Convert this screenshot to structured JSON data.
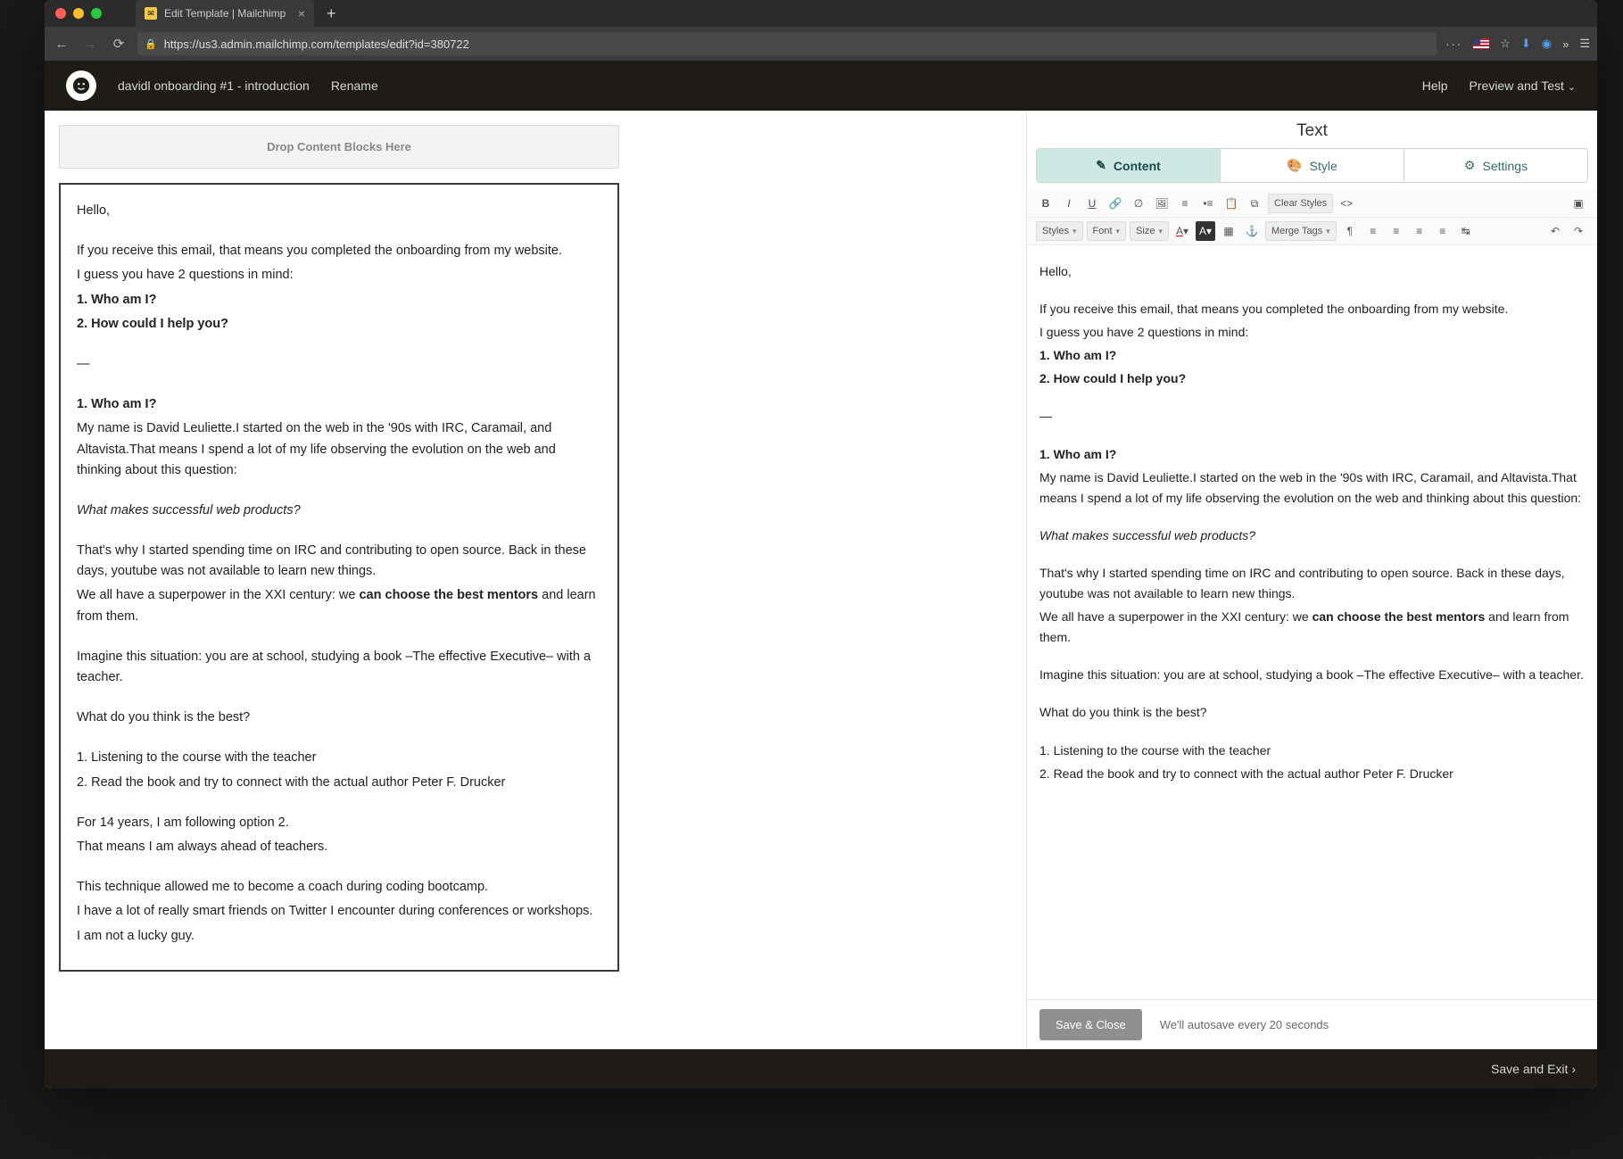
{
  "browser": {
    "tab_title": "Edit Template | Mailchimp",
    "url": "https://us3.admin.mailchimp.com/templates/edit?id=380722"
  },
  "mctop": {
    "template_name": "davidl onboarding #1 - introduction",
    "rename": "Rename",
    "help": "Help",
    "preview": "Preview and Test"
  },
  "dropzone": "Drop Content Blocks Here",
  "email": {
    "hello": "Hello,",
    "intro1": "If you receive this email, that means you completed the onboarding from my website.",
    "intro2": "I guess you have 2 questions in mind:",
    "q1": "1. Who am I?",
    "q2": "2. How could I help you?",
    "dash": "—",
    "h_who": "1. Who am I?",
    "who1": "My name is David Leuliette.I started on the web in the '90s with IRC, Caramail, and Altavista.That means I spend a lot of my life observing the evolution on the web and thinking about this question:",
    "who_q": "What makes successful web products?",
    "p1": "That's why I started spending time on IRC and contributing to open source. Back in these days, youtube was not available to learn new things.",
    "p2a": "We all have a superpower in the XXI century: we ",
    "p2b": "can choose the best mentors",
    "p2c": " and learn from them.",
    "p3": "Imagine this situation: you are at school, studying a book –The effective Executive– with a teacher.",
    "p4": "What do you think is the best?",
    "opt1": "1. Listening to the course with the teacher",
    "opt2": "2. Read the book and try to connect with the actual author Peter F. Drucker",
    "p5": "For 14 years, I am following option 2.",
    "p6": "That means I am always ahead of teachers.",
    "p7": "This technique allowed me to become a coach during coding bootcamp.",
    "p8": "I have a lot of really smart friends on Twitter I encounter during conferences or workshops.",
    "p9": "I am not a lucky guy."
  },
  "panel": {
    "title": "Text",
    "tabs": {
      "content": "Content",
      "style": "Style",
      "settings": "Settings"
    },
    "toolbar": {
      "clear_styles": "Clear Styles",
      "styles": "Styles",
      "font": "Font",
      "size": "Size",
      "merge_tags": "Merge Tags"
    },
    "save_close": "Save & Close",
    "autosave_msg": "We'll autosave every 20 seconds"
  },
  "footer": {
    "save_exit": "Save and Exit"
  }
}
